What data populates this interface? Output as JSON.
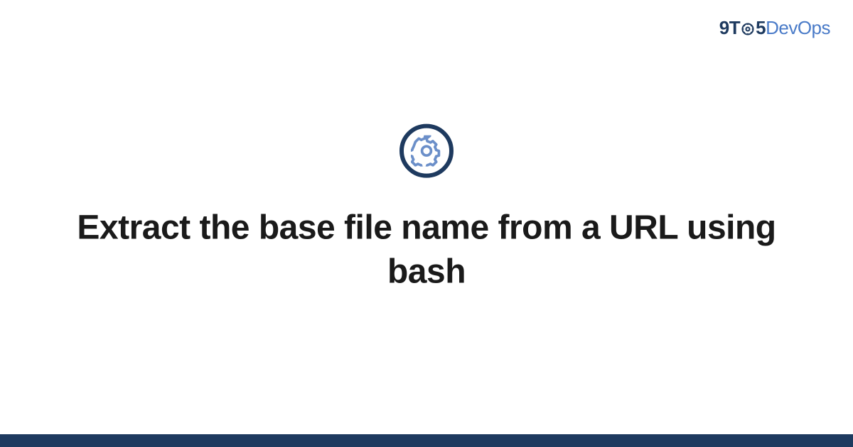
{
  "brand": {
    "part1": "9",
    "part2": "T",
    "part3": "5",
    "part4": "DevOps"
  },
  "title": "Extract the base file name from a URL using bash",
  "colors": {
    "dark_blue": "#1e3a5f",
    "light_blue": "#4a7bc8",
    "gear_stroke": "#6b8fc9"
  }
}
